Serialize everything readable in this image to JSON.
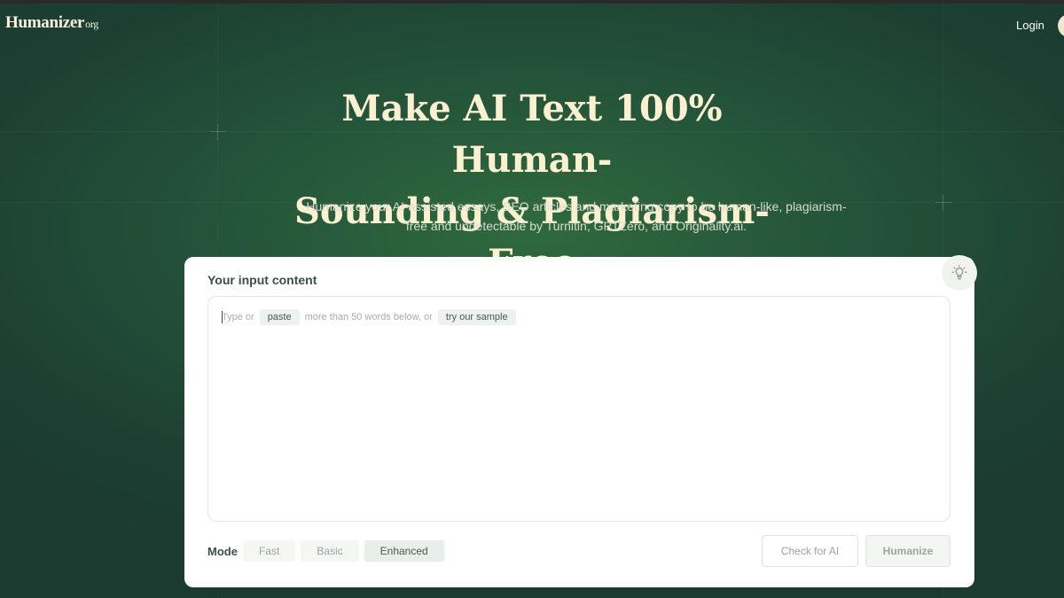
{
  "header": {
    "logo_main": "Humanizer",
    "logo_suffix": "org",
    "login_label": "Login"
  },
  "hero": {
    "title_line1": "Make AI Text 100% Human-",
    "title_line2": "Sounding & Plagiarism-Free",
    "subtitle_line1": "Humanize your AI-assisted essays, SEO articles and marketing copy to be human-like, plagiarism-",
    "subtitle_line2": "free and undetectable by Turnitin, GPTZero, and Originality.ai."
  },
  "editor": {
    "label": "Your input content",
    "hint_prefix": "Type or",
    "paste_chip": "paste",
    "hint_middle": "more than 50 words below, or",
    "sample_chip": "try our sample",
    "mode_label": "Mode",
    "modes": [
      "Fast",
      "Basic",
      "Enhanced"
    ],
    "selected_mode": "Enhanced",
    "check_label": "Check for AI",
    "humanize_label": "Humanize",
    "tip_icon": "lightbulb-icon"
  },
  "colors": {
    "background_dark": "#1d3f33",
    "background_glow": "#2f6a3e",
    "title_cream": "#fbf0cf",
    "card_white": "#ffffff"
  }
}
